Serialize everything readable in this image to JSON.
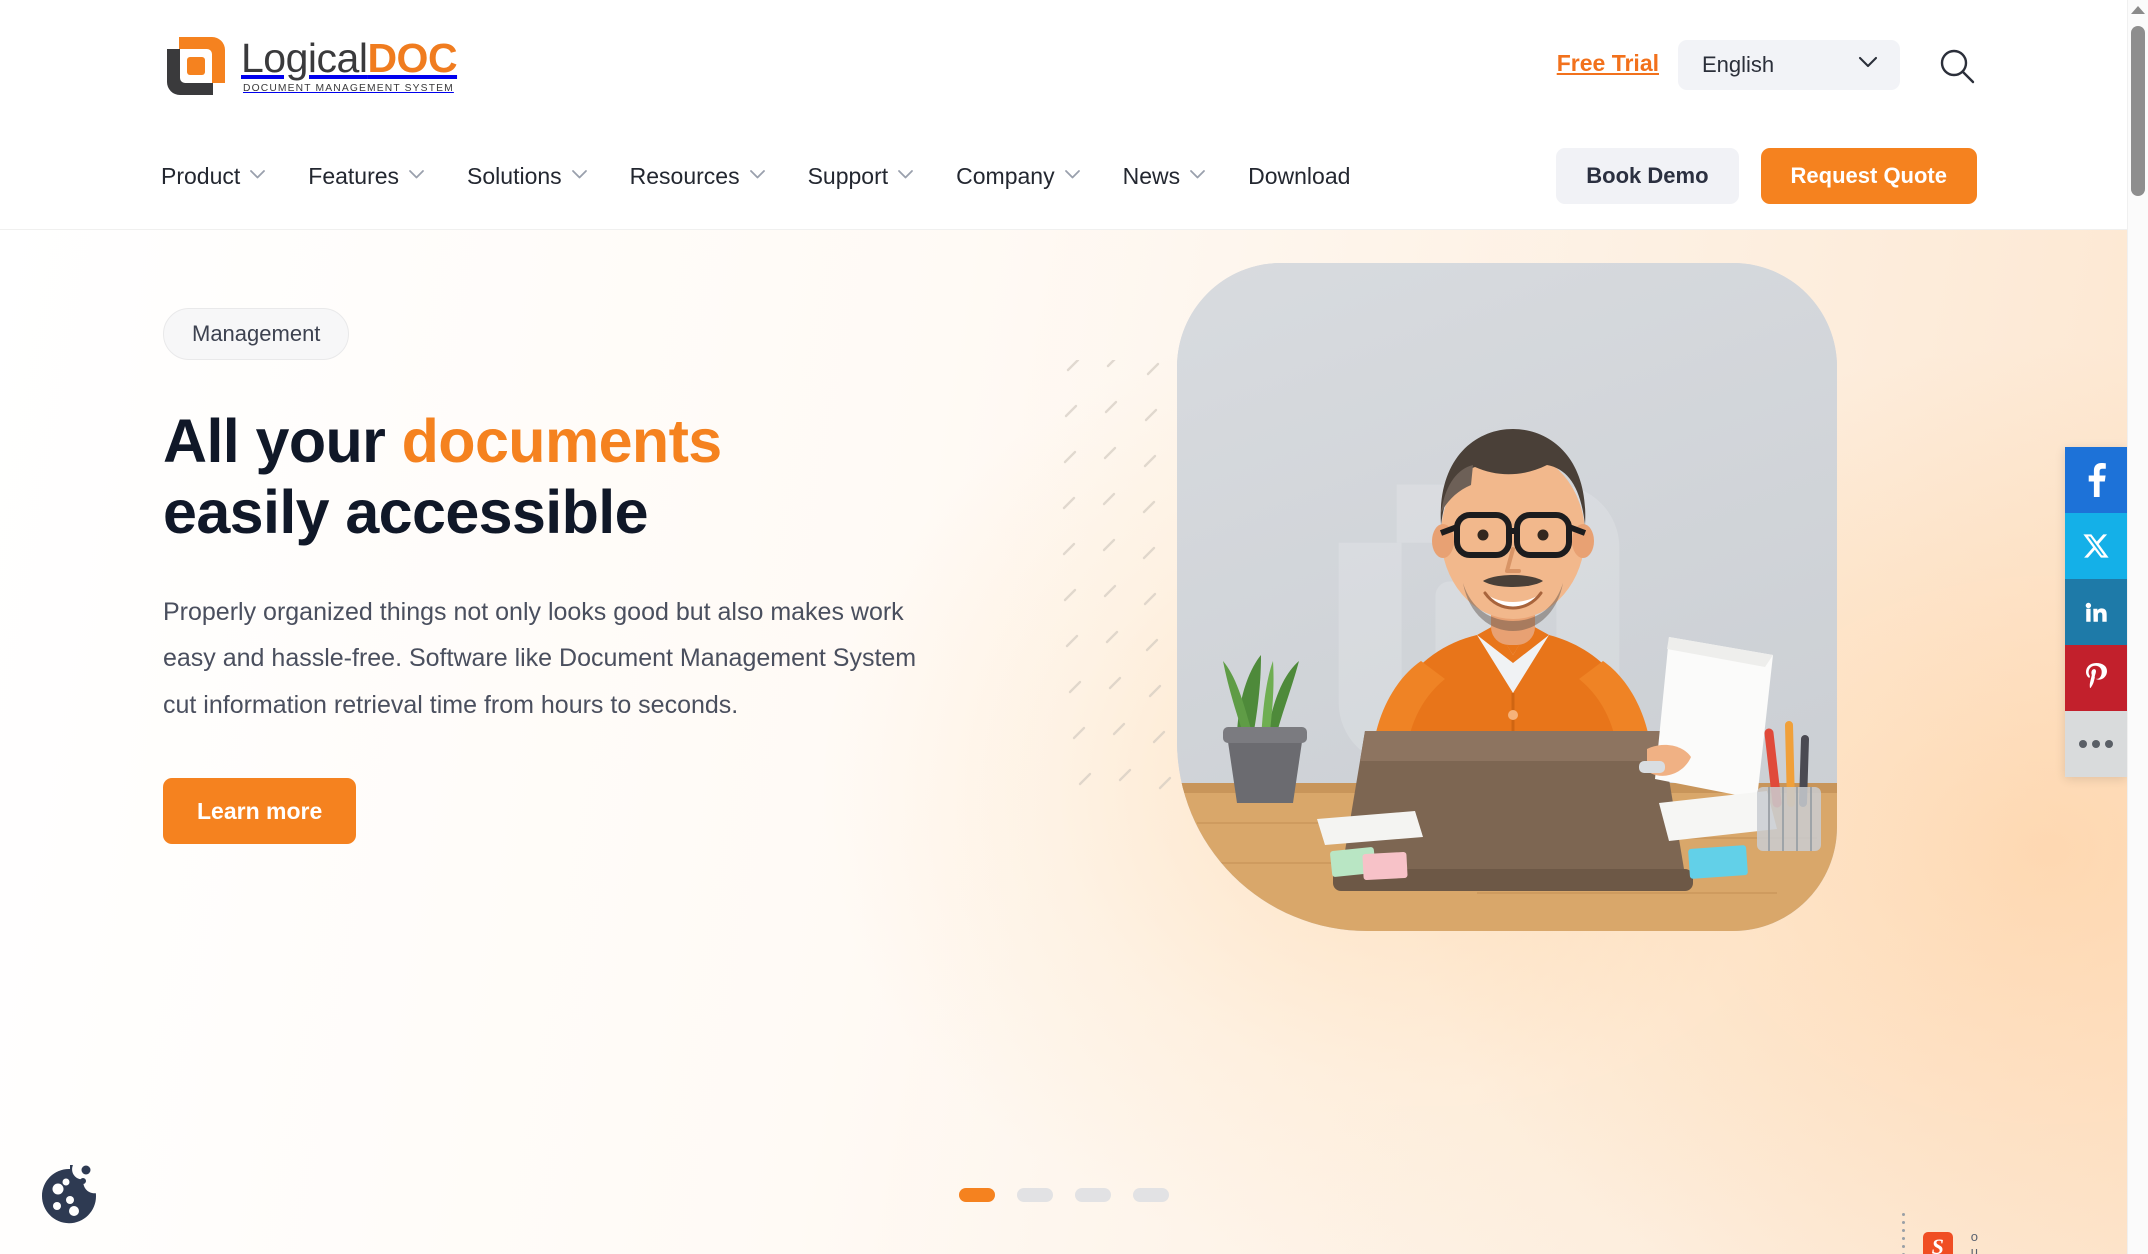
{
  "brand": {
    "logo_name_part1": "Logical",
    "logo_name_part2": "DOC",
    "logo_tagline": "DOCUMENT MANAGEMENT SYSTEM",
    "accent_color": "#f5821f",
    "dark_color": "#3a3a3c"
  },
  "topbar": {
    "free_trial_label": "Free Trial",
    "language_value": "English",
    "language_options": [
      "English"
    ],
    "search_icon": "search-icon",
    "chevron_icon": "chevron-down-icon"
  },
  "nav": {
    "items": [
      {
        "label": "Product",
        "has_dropdown": true
      },
      {
        "label": "Features",
        "has_dropdown": true
      },
      {
        "label": "Solutions",
        "has_dropdown": true
      },
      {
        "label": "Resources",
        "has_dropdown": true
      },
      {
        "label": "Support",
        "has_dropdown": true
      },
      {
        "label": "Company",
        "has_dropdown": true
      },
      {
        "label": "News",
        "has_dropdown": true
      },
      {
        "label": "Download",
        "has_dropdown": false
      }
    ],
    "book_demo_label": "Book Demo",
    "request_quote_label": "Request Quote"
  },
  "hero": {
    "badge": "Management",
    "headline_part1": "All your ",
    "headline_accent": "documents",
    "headline_part2": "easily accessible",
    "body": "Properly organized things not only looks good but also makes work easy and hassle-free. Software like Document Management System cut information retrieval time from hours to seconds.",
    "cta_label": "Learn more",
    "image_alt": "Man in orange shirt with glasses at a desk with a laptop, papers, plant and pencil holder"
  },
  "carousel": {
    "slide_count": 4,
    "active_index": 0
  },
  "social": {
    "items": [
      {
        "name": "facebook",
        "glyph": "f",
        "color": "#1d72d8"
      },
      {
        "name": "x-twitter",
        "glyph": "X",
        "color": "#14b0e8"
      },
      {
        "name": "linkedin",
        "glyph": "in",
        "color": "#1e7aa8"
      },
      {
        "name": "pinterest",
        "glyph": "P",
        "color": "#c2202c"
      },
      {
        "name": "more-options",
        "glyph": "•••",
        "color": "#d9dbdc"
      }
    ]
  },
  "cookie": {
    "icon": "cookie-icon"
  },
  "bottom_widgets": {
    "s_badge": "S"
  },
  "scrollbar": {
    "position": "top"
  }
}
